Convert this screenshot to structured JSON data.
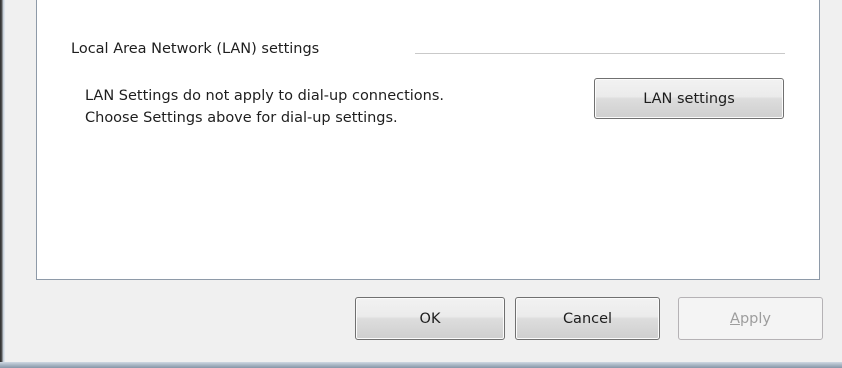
{
  "lan_group": {
    "legend": "Local Area Network (LAN) settings",
    "description_line1": "LAN Settings do not apply to dial-up connections.",
    "description_line2": "Choose Settings above for dial-up settings.",
    "button_label": "LAN settings"
  },
  "dialog_buttons": {
    "ok_label": "OK",
    "cancel_label": "Cancel",
    "apply_accel": "A",
    "apply_rest": "pply",
    "apply_enabled": false
  }
}
